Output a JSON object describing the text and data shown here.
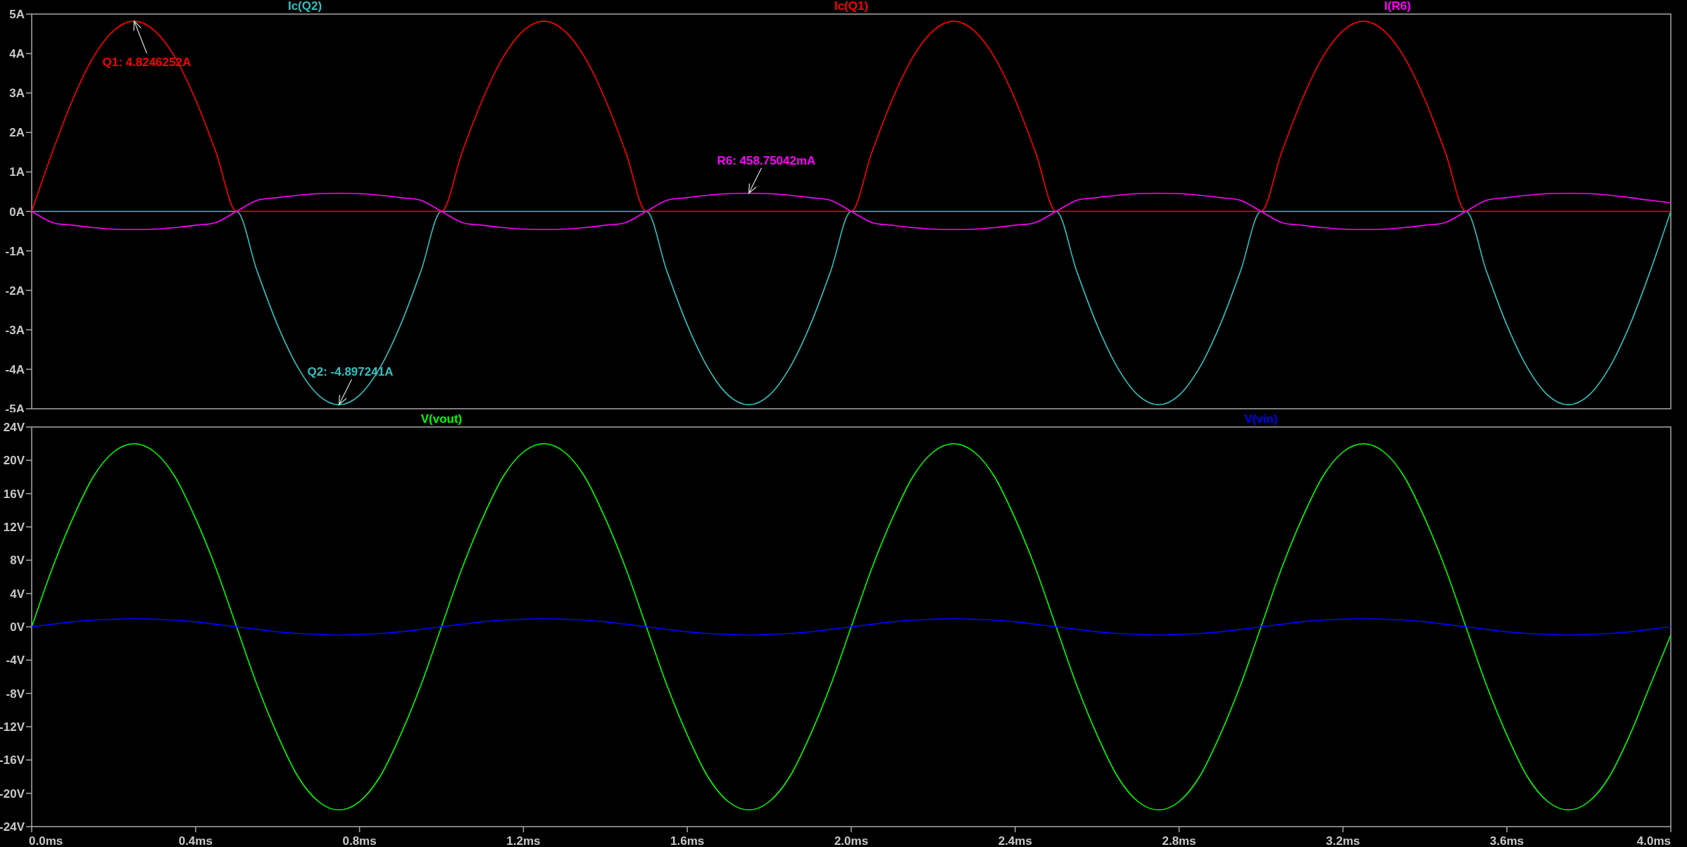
{
  "plots": [
    {
      "chart_data": {
        "type": "line",
        "xlim": [
          0,
          4
        ],
        "ylim": [
          -5,
          5
        ],
        "x": [
          0,
          0.05,
          0.1,
          0.15,
          0.2,
          0.25,
          0.3,
          0.35,
          0.4,
          0.45,
          0.5,
          0.55,
          0.6,
          0.65,
          0.7,
          0.75,
          0.8,
          0.85,
          0.9,
          0.95,
          1,
          1.05,
          1.1,
          1.15,
          1.2,
          1.25,
          1.3,
          1.35,
          1.4,
          1.45,
          1.5,
          1.55,
          1.6,
          1.65,
          1.7,
          1.75,
          1.8,
          1.85,
          1.9,
          1.95,
          2,
          2.05,
          2.1,
          2.15,
          2.2,
          2.25,
          2.3,
          2.35,
          2.4,
          2.45,
          2.5,
          2.55,
          2.6,
          2.65,
          2.7,
          2.75,
          2.8,
          2.85,
          2.9,
          2.95,
          3,
          3.05,
          3.1,
          3.15,
          3.2,
          3.25,
          3.3,
          3.35,
          3.4,
          3.45,
          3.5,
          3.55,
          3.6,
          3.65,
          3.7,
          3.75,
          3.8,
          3.85,
          3.9,
          3.95,
          4
        ],
        "yticks": [
          {
            "value": 5,
            "label": "5A"
          },
          {
            "value": 4,
            "label": "4A"
          },
          {
            "value": 3,
            "label": "3A"
          },
          {
            "value": 2,
            "label": "2A"
          },
          {
            "value": 1,
            "label": "1A"
          },
          {
            "value": 0,
            "label": "0A"
          },
          {
            "value": -1,
            "label": "-1A"
          },
          {
            "value": -2,
            "label": "-2A"
          },
          {
            "value": -3,
            "label": "-3A"
          },
          {
            "value": -4,
            "label": "-4A"
          },
          {
            "value": -5,
            "label": "-5A"
          }
        ],
        "series": [
          {
            "name": "Ic(Q2)",
            "color": "#33c0c0",
            "values": [
              0,
              0,
              0,
              0,
              0,
              0,
              0,
              0,
              0,
              0,
              0,
              -1.51,
              -2.88,
              -3.96,
              -4.66,
              -4.9,
              -4.66,
              -3.96,
              -2.88,
              -1.51,
              0,
              0,
              0,
              0,
              0,
              0,
              0,
              0,
              0,
              0,
              0,
              -1.51,
              -2.88,
              -3.96,
              -4.66,
              -4.9,
              -4.66,
              -3.96,
              -2.88,
              -1.51,
              0,
              0,
              0,
              0,
              0,
              0,
              0,
              0,
              0,
              0,
              0,
              -1.51,
              -2.88,
              -3.96,
              -4.66,
              -4.9,
              -4.66,
              -3.96,
              -2.88,
              -1.51,
              0,
              0,
              0,
              0,
              0,
              0,
              0,
              0,
              0,
              0,
              0,
              -1.51,
              -2.88,
              -3.96,
              -4.66,
              -4.9,
              -4.66,
              -3.96,
              -2.88,
              -1.51,
              0
            ]
          },
          {
            "name": "Ic(Q1)",
            "color": "#ff0000",
            "values": [
              0,
              1.49,
              2.83,
              3.9,
              4.58,
              4.82,
              4.58,
              3.9,
              2.83,
              1.49,
              0,
              0,
              0,
              0,
              0,
              0,
              0,
              0,
              0,
              0,
              0,
              1.49,
              2.83,
              3.9,
              4.58,
              4.82,
              4.58,
              3.9,
              2.83,
              1.49,
              0,
              0,
              0,
              0,
              0,
              0,
              0,
              0,
              0,
              0,
              0,
              1.49,
              2.83,
              3.9,
              4.58,
              4.82,
              4.58,
              3.9,
              2.83,
              1.49,
              0,
              0,
              0,
              0,
              0,
              0,
              0,
              0,
              0,
              0,
              0,
              1.49,
              2.83,
              3.9,
              4.58,
              4.82,
              4.58,
              3.9,
              2.83,
              1.49,
              0,
              0,
              0,
              0,
              0,
              0,
              0,
              0,
              0,
              0,
              0
            ]
          },
          {
            "name": "I(R6)",
            "color": "#ff00ff",
            "values": [
              0,
              -0.28,
              -0.35,
              -0.41,
              -0.45,
              -0.46,
              -0.45,
              -0.41,
              -0.35,
              -0.28,
              0,
              0.28,
              0.35,
              0.41,
              0.45,
              0.46,
              0.45,
              0.41,
              0.35,
              0.28,
              0,
              -0.28,
              -0.35,
              -0.41,
              -0.45,
              -0.46,
              -0.45,
              -0.41,
              -0.35,
              -0.28,
              0,
              0.28,
              0.35,
              0.41,
              0.45,
              0.46,
              0.45,
              0.41,
              0.35,
              0.28,
              0,
              -0.28,
              -0.35,
              -0.41,
              -0.45,
              -0.46,
              -0.45,
              -0.41,
              -0.35,
              -0.28,
              0,
              0.28,
              0.35,
              0.41,
              0.45,
              0.46,
              0.45,
              0.41,
              0.35,
              0.28,
              0,
              -0.28,
              -0.35,
              -0.41,
              -0.45,
              -0.46,
              -0.45,
              -0.41,
              -0.35,
              -0.28,
              0,
              0.28,
              0.35,
              0.41,
              0.45,
              0.46,
              0.45,
              0.41,
              0.35,
              0.28,
              0.22
            ]
          }
        ],
        "annotations": [
          {
            "text": "Q1: 4.8246252A",
            "x": 0.25,
            "y": 4.8246
          },
          {
            "text": "Q2: -4.897241A",
            "x": 0.75,
            "y": -4.8972
          },
          {
            "text": "R6: 458.75042mA",
            "x": 1.75,
            "y": 0.4588
          }
        ]
      }
    },
    {
      "chart_data": {
        "type": "line",
        "xlim": [
          0,
          4
        ],
        "ylim": [
          -24,
          24
        ],
        "x": [
          0,
          0.05,
          0.1,
          0.15,
          0.2,
          0.25,
          0.3,
          0.35,
          0.4,
          0.45,
          0.5,
          0.55,
          0.6,
          0.65,
          0.7,
          0.75,
          0.8,
          0.85,
          0.9,
          0.95,
          1,
          1.05,
          1.1,
          1.15,
          1.2,
          1.25,
          1.3,
          1.35,
          1.4,
          1.45,
          1.5,
          1.55,
          1.6,
          1.65,
          1.7,
          1.75,
          1.8,
          1.85,
          1.9,
          1.95,
          2,
          2.05,
          2.1,
          2.15,
          2.2,
          2.25,
          2.3,
          2.35,
          2.4,
          2.45,
          2.5,
          2.55,
          2.6,
          2.65,
          2.7,
          2.75,
          2.8,
          2.85,
          2.9,
          2.95,
          3,
          3.05,
          3.1,
          3.15,
          3.2,
          3.25,
          3.3,
          3.35,
          3.4,
          3.45,
          3.5,
          3.55,
          3.6,
          3.65,
          3.7,
          3.75,
          3.8,
          3.85,
          3.9,
          3.95,
          4
        ],
        "xticks": [
          {
            "value": 0,
            "label": "0.0ms"
          },
          {
            "value": 0.4,
            "label": "0.4ms"
          },
          {
            "value": 0.8,
            "label": "0.8ms"
          },
          {
            "value": 1.2,
            "label": "1.2ms"
          },
          {
            "value": 1.6,
            "label": "1.6ms"
          },
          {
            "value": 2,
            "label": "2.0ms"
          },
          {
            "value": 2.4,
            "label": "2.4ms"
          },
          {
            "value": 2.8,
            "label": "2.8ms"
          },
          {
            "value": 3.2,
            "label": "3.2ms"
          },
          {
            "value": 3.6,
            "label": "3.6ms"
          },
          {
            "value": 4,
            "label": "4.0ms"
          }
        ],
        "yticks": [
          {
            "value": 24,
            "label": "24V"
          },
          {
            "value": 20,
            "label": "20V"
          },
          {
            "value": 16,
            "label": "16V"
          },
          {
            "value": 12,
            "label": "12V"
          },
          {
            "value": 8,
            "label": "8V"
          },
          {
            "value": 4,
            "label": "4V"
          },
          {
            "value": 0,
            "label": "0V"
          },
          {
            "value": -4,
            "label": "-4V"
          },
          {
            "value": -8,
            "label": "-8V"
          },
          {
            "value": -12,
            "label": "-12V"
          },
          {
            "value": -16,
            "label": "-16V"
          },
          {
            "value": -20,
            "label": "-20V"
          },
          {
            "value": -24,
            "label": "-24V"
          }
        ],
        "series": [
          {
            "name": "V(vout)",
            "color": "#00ff00",
            "values": [
              0,
              7,
              13,
              18,
              21,
              22,
              21,
              18,
              13,
              7,
              0,
              -7,
              -13,
              -18,
              -21,
              -22,
              -21,
              -18,
              -13,
              -7,
              0,
              7,
              13,
              18,
              21,
              22,
              21,
              18,
              13,
              7,
              0,
              -7,
              -13,
              -18,
              -21,
              -22,
              -21,
              -18,
              -13,
              -7,
              0,
              7,
              13,
              18,
              21,
              22,
              21,
              18,
              13,
              7,
              0,
              -7,
              -13,
              -18,
              -21,
              -22,
              -21,
              -18,
              -13,
              -7,
              0,
              7,
              13,
              18,
              21,
              22,
              21,
              18,
              13,
              7,
              0,
              -7,
              -13,
              -18,
              -21,
              -22,
              -21,
              -18,
              -13,
              -7,
              -1
            ]
          },
          {
            "name": "V(vin)",
            "color": "#0000ff",
            "values": [
              0,
              0.3,
              0.6,
              0.8,
              0.9,
              1,
              0.9,
              0.8,
              0.6,
              0.3,
              0,
              -0.3,
              -0.6,
              -0.8,
              -0.9,
              -1,
              -0.9,
              -0.8,
              -0.6,
              -0.3,
              0,
              0.3,
              0.6,
              0.8,
              0.9,
              1,
              0.9,
              0.8,
              0.6,
              0.3,
              0,
              -0.3,
              -0.6,
              -0.8,
              -0.9,
              -1,
              -0.9,
              -0.8,
              -0.6,
              -0.3,
              0,
              0.3,
              0.6,
              0.8,
              0.9,
              1,
              0.9,
              0.8,
              0.6,
              0.3,
              0,
              -0.3,
              -0.6,
              -0.8,
              -0.9,
              -1,
              -0.9,
              -0.8,
              -0.6,
              -0.3,
              0,
              0.3,
              0.6,
              0.8,
              0.9,
              1,
              0.9,
              0.8,
              0.6,
              0.3,
              0,
              -0.3,
              -0.6,
              -0.8,
              -0.9,
              -1,
              -0.9,
              -0.8,
              -0.6,
              -0.3,
              0
            ]
          }
        ]
      }
    }
  ]
}
